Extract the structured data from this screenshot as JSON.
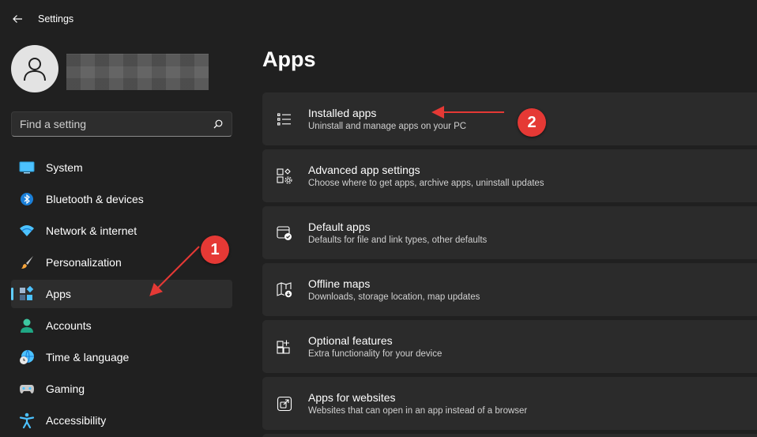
{
  "window": {
    "title": "Settings"
  },
  "search": {
    "placeholder": "Find a setting"
  },
  "sidebar": {
    "items": [
      {
        "label": "System",
        "icon": "system-icon"
      },
      {
        "label": "Bluetooth & devices",
        "icon": "bluetooth-icon"
      },
      {
        "label": "Network & internet",
        "icon": "wifi-icon"
      },
      {
        "label": "Personalization",
        "icon": "brush-icon"
      },
      {
        "label": "Apps",
        "icon": "apps-icon",
        "active": true
      },
      {
        "label": "Accounts",
        "icon": "person-icon"
      },
      {
        "label": "Time & language",
        "icon": "globe-clock-icon"
      },
      {
        "label": "Gaming",
        "icon": "gamepad-icon"
      },
      {
        "label": "Accessibility",
        "icon": "accessibility-icon"
      }
    ]
  },
  "main": {
    "title": "Apps",
    "cards": [
      {
        "title": "Installed apps",
        "description": "Uninstall and manage apps on your PC",
        "icon": "list-icon"
      },
      {
        "title": "Advanced app settings",
        "description": "Choose where to get apps, archive apps, uninstall updates",
        "icon": "app-settings-icon"
      },
      {
        "title": "Default apps",
        "description": "Defaults for file and link types, other defaults",
        "icon": "default-apps-icon"
      },
      {
        "title": "Offline maps",
        "description": "Downloads, storage location, map updates",
        "icon": "map-icon"
      },
      {
        "title": "Optional features",
        "description": "Extra functionality for your device",
        "icon": "add-features-icon"
      },
      {
        "title": "Apps for websites",
        "description": "Websites that can open in an app instead of a browser",
        "icon": "open-in-app-icon"
      }
    ]
  },
  "annotations": {
    "badge_1": "1",
    "badge_2": "2"
  },
  "colors": {
    "accent": "#60cdff",
    "badge": "#e53935",
    "background": "#202020",
    "card": "#2b2b2b"
  }
}
